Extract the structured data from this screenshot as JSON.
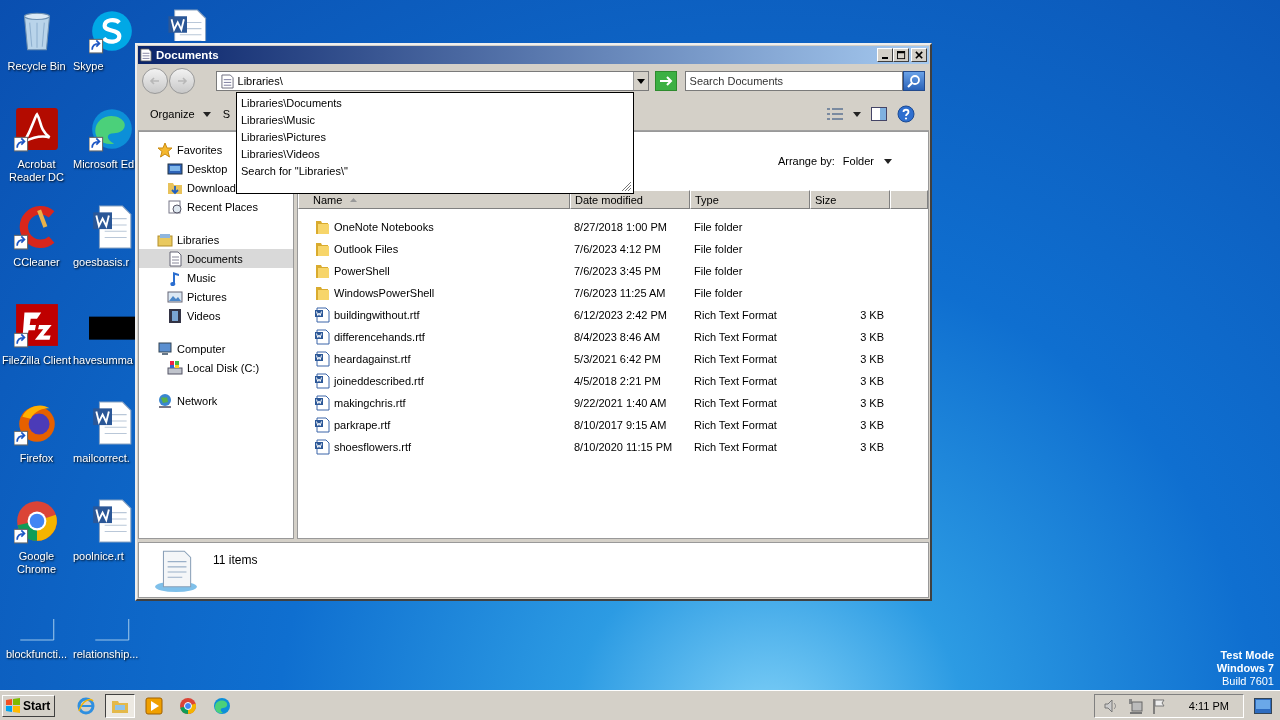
{
  "desktop_icons": [
    {
      "label": "Recycle Bin",
      "kind": "recycle",
      "shortcut": false
    },
    {
      "label": "Acrobat\nReader DC",
      "kind": "acrobat",
      "shortcut": true
    },
    {
      "label": "CCleaner",
      "kind": "ccleaner",
      "shortcut": true
    },
    {
      "label": "FileZilla Client",
      "kind": "filezilla",
      "shortcut": true
    },
    {
      "label": "Firefox",
      "kind": "firefox",
      "shortcut": true
    },
    {
      "label": "Google\nChrome",
      "kind": "chrome",
      "shortcut": true
    },
    {
      "label": "blockfuncti...",
      "kind": "blank",
      "shortcut": false
    },
    {
      "label": "Skype",
      "kind": "skype",
      "shortcut": true
    },
    {
      "label": "Microsoft Ed",
      "kind": "edge",
      "shortcut": true
    },
    {
      "label": "goesbasis.r",
      "kind": "word",
      "shortcut": false
    },
    {
      "label": "havesumma",
      "kind": "thumb",
      "shortcut": false
    },
    {
      "label": "mailcorrect.",
      "kind": "word",
      "shortcut": false
    },
    {
      "label": "poolnice.rt",
      "kind": "word",
      "shortcut": false
    },
    {
      "label": "relationship...",
      "kind": "blank",
      "shortcut": false
    },
    {
      "kind": "word",
      "shortcut": false
    }
  ],
  "window": {
    "title": "Documents",
    "address": {
      "value": "Libraries\\"
    },
    "search": {
      "placeholder": "Search Documents"
    },
    "toolbar": [
      {
        "label": "Organize",
        "menu": true
      },
      {
        "label": "S",
        "menu": false
      }
    ],
    "suggestions": [
      "Libraries\\Documents",
      "Libraries\\Music",
      "Libraries\\Pictures",
      "Libraries\\Videos",
      "Search for \"Libraries\\\""
    ],
    "nav": [
      {
        "label": "Favorites",
        "kind": "star",
        "selected": false,
        "children": [
          {
            "label": "Desktop",
            "kind": "desktop",
            "selected": false
          },
          {
            "label": "Download",
            "kind": "downloads",
            "selected": false
          },
          {
            "label": "Recent Places",
            "kind": "recent",
            "selected": false
          }
        ]
      },
      {
        "label": "Libraries",
        "kind": "libraries",
        "selected": false,
        "children": [
          {
            "label": "Documents",
            "kind": "doc",
            "selected": true
          },
          {
            "label": "Music",
            "kind": "music",
            "selected": false
          },
          {
            "label": "Pictures",
            "kind": "pictures",
            "selected": false
          },
          {
            "label": "Videos",
            "kind": "videos",
            "selected": false
          }
        ]
      },
      {
        "label": "Computer",
        "kind": "computer",
        "selected": false,
        "children": [
          {
            "label": "Local Disk (C:)",
            "kind": "disk",
            "selected": false
          }
        ]
      },
      {
        "label": "Network",
        "kind": "network",
        "selected": false
      }
    ],
    "arrange": {
      "label": "Arrange by:",
      "value": "Folder"
    },
    "columns": [
      "Name",
      "Date modified",
      "Type",
      "Size"
    ],
    "files": [
      {
        "name": "OneNote Notebooks",
        "date": "8/27/2018 1:00 PM",
        "type": "File folder",
        "kind": "folder"
      },
      {
        "name": "Outlook Files",
        "date": "7/6/2023 4:12 PM",
        "type": "File folder",
        "kind": "folder"
      },
      {
        "name": "PowerShell",
        "date": "7/6/2023 3:45 PM",
        "type": "File folder",
        "kind": "folder"
      },
      {
        "name": "WindowsPowerShell",
        "date": "7/6/2023 11:25 AM",
        "type": "File folder",
        "kind": "folder"
      },
      {
        "name": "buildingwithout.rtf",
        "date": "6/12/2023 2:42 PM",
        "type": "Rich Text Format",
        "size": "3 KB",
        "kind": "rtf"
      },
      {
        "name": "differencehands.rtf",
        "date": "8/4/2023 8:46 AM",
        "type": "Rich Text Format",
        "size": "3 KB",
        "kind": "rtf"
      },
      {
        "name": "heardagainst.rtf",
        "date": "5/3/2021 6:42 PM",
        "type": "Rich Text Format",
        "size": "3 KB",
        "kind": "rtf"
      },
      {
        "name": "joineddescribed.rtf",
        "date": "4/5/2018 2:21 PM",
        "type": "Rich Text Format",
        "size": "3 KB",
        "kind": "rtf"
      },
      {
        "name": "makingchris.rtf",
        "date": "9/22/2021 1:40 AM",
        "type": "Rich Text Format",
        "size": "3 KB",
        "kind": "rtf"
      },
      {
        "name": "parkrape.rtf",
        "date": "8/10/2017 9:15 AM",
        "type": "Rich Text Format",
        "size": "3 KB",
        "kind": "rtf"
      },
      {
        "name": "shoesflowers.rtf",
        "date": "8/10/2020 11:15 PM",
        "type": "Rich Text Format",
        "size": "3 KB",
        "kind": "rtf"
      }
    ],
    "status": "11 items"
  },
  "desktop_notice": [
    "Test Mode",
    "Windows 7",
    "Build 7601"
  ],
  "taskbar": {
    "start": "Start",
    "apps": [
      {
        "kind": "ie",
        "active": false
      },
      {
        "kind": "explorer",
        "active": true
      },
      {
        "kind": "media",
        "active": false
      },
      {
        "kind": "chrome",
        "active": false
      },
      {
        "kind": "edge",
        "active": false
      }
    ],
    "clock": "4:11 PM"
  }
}
